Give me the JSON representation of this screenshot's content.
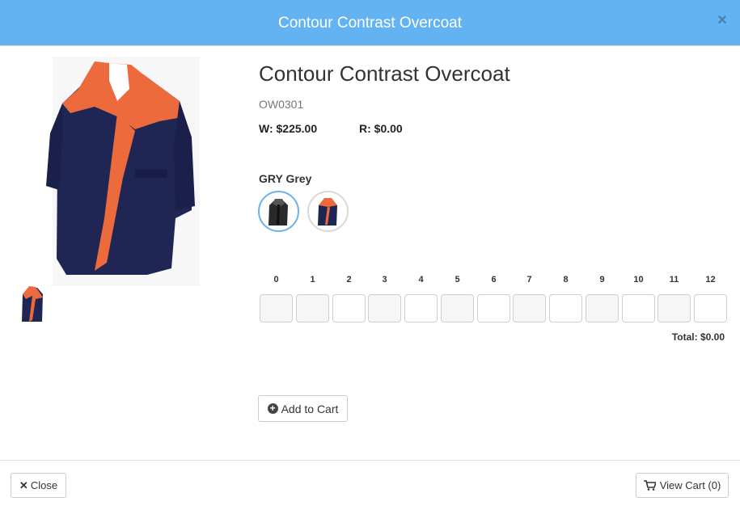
{
  "header": {
    "title": "Contour Contrast Overcoat",
    "close_icon": "×"
  },
  "product": {
    "name": "Contour Contrast Overcoat",
    "sku": "OW0301",
    "wholesale": "W: $225.00",
    "retail": "R: $0.00",
    "color_label": "GRY Grey",
    "swatches": [
      {
        "icon": "coat-grey-swatch",
        "selected": true
      },
      {
        "icon": "coat-navy-orange-swatch",
        "selected": false
      }
    ]
  },
  "sizes": [
    "0",
    "1",
    "2",
    "3",
    "4",
    "5",
    "6",
    "7",
    "8",
    "9",
    "10",
    "11",
    "12"
  ],
  "total": "Total: $0.00",
  "buttons": {
    "add_to_cart": "Add to Cart",
    "close": "Close",
    "view_cart": "View Cart (0)"
  },
  "colors": {
    "header": "#63b3f2",
    "accent": "#ec6a3c",
    "navy": "#1f2653"
  }
}
